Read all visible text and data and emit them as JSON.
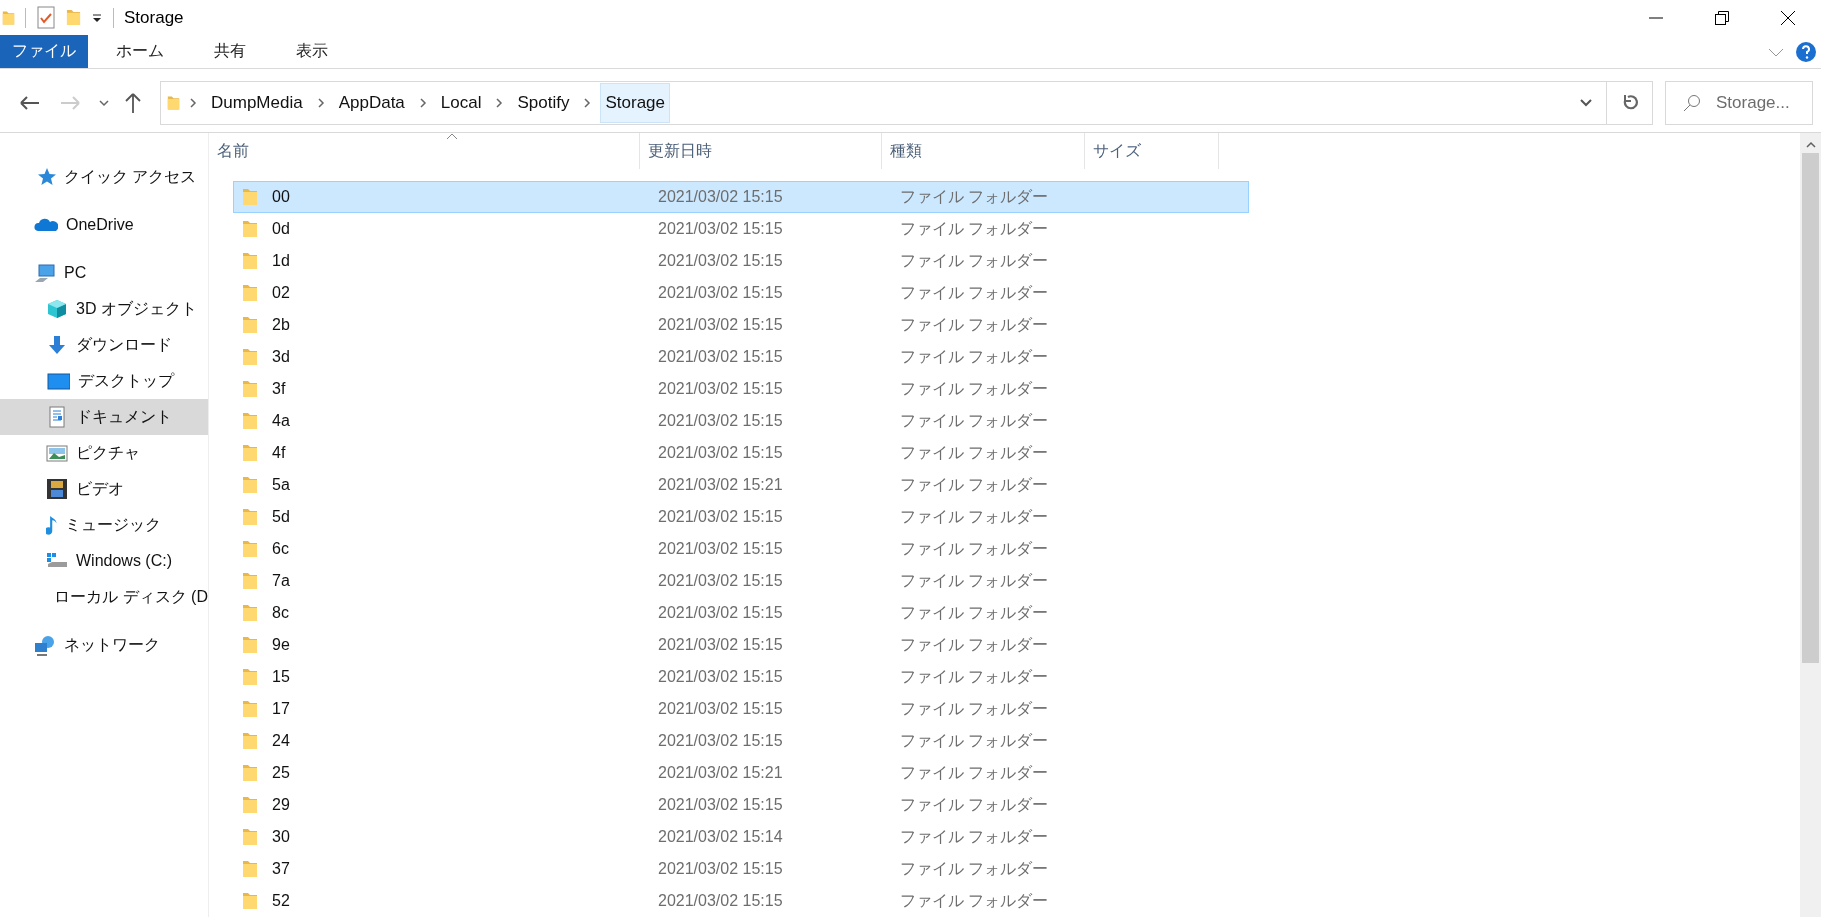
{
  "window": {
    "title": "Storage"
  },
  "ribbon": {
    "tabs": [
      {
        "label": "ファイル",
        "kind": "file"
      },
      {
        "label": "ホーム",
        "kind": "tab"
      },
      {
        "label": "共有",
        "kind": "tab"
      },
      {
        "label": "表示",
        "kind": "tab"
      }
    ]
  },
  "address": {
    "crumbs": [
      {
        "label": "DumpMedia",
        "selected": false
      },
      {
        "label": "AppData",
        "selected": false
      },
      {
        "label": "Local",
        "selected": false
      },
      {
        "label": "Spotify",
        "selected": false
      },
      {
        "label": "Storage",
        "selected": true
      }
    ]
  },
  "search": {
    "placeholder": "Storage..."
  },
  "sidebar": {
    "items": [
      {
        "label": "クイック アクセス",
        "kind": "star",
        "selected": false
      },
      {
        "label": "OneDrive",
        "kind": "cloud",
        "selected": false
      },
      {
        "label": "PC",
        "kind": "pc",
        "selected": false,
        "children": [
          {
            "label": "3D オブジェクト",
            "kind": "cube",
            "selected": false
          },
          {
            "label": "ダウンロード",
            "kind": "download",
            "selected": false
          },
          {
            "label": "デスクトップ",
            "kind": "desktop",
            "selected": false
          },
          {
            "label": "ドキュメント",
            "kind": "document",
            "selected": true
          },
          {
            "label": "ピクチャ",
            "kind": "picture",
            "selected": false
          },
          {
            "label": "ビデオ",
            "kind": "video",
            "selected": false
          },
          {
            "label": "ミュージック",
            "kind": "music",
            "selected": false
          },
          {
            "label": "Windows (C:)",
            "kind": "system-drive",
            "selected": false
          },
          {
            "label": "ローカル ディスク (D",
            "kind": "drive",
            "selected": false
          }
        ]
      },
      {
        "label": "ネットワーク",
        "kind": "network",
        "selected": false
      }
    ]
  },
  "columns": [
    "名前",
    "更新日時",
    "種類",
    "サイズ"
  ],
  "rows": [
    {
      "name": "00",
      "modified": "2021/03/02 15:15",
      "type": "ファイル フォルダー",
      "selected": true
    },
    {
      "name": "0d",
      "modified": "2021/03/02 15:15",
      "type": "ファイル フォルダー",
      "selected": false
    },
    {
      "name": "1d",
      "modified": "2021/03/02 15:15",
      "type": "ファイル フォルダー",
      "selected": false
    },
    {
      "name": "02",
      "modified": "2021/03/02 15:15",
      "type": "ファイル フォルダー",
      "selected": false
    },
    {
      "name": "2b",
      "modified": "2021/03/02 15:15",
      "type": "ファイル フォルダー",
      "selected": false
    },
    {
      "name": "3d",
      "modified": "2021/03/02 15:15",
      "type": "ファイル フォルダー",
      "selected": false
    },
    {
      "name": "3f",
      "modified": "2021/03/02 15:15",
      "type": "ファイル フォルダー",
      "selected": false
    },
    {
      "name": "4a",
      "modified": "2021/03/02 15:15",
      "type": "ファイル フォルダー",
      "selected": false
    },
    {
      "name": "4f",
      "modified": "2021/03/02 15:15",
      "type": "ファイル フォルダー",
      "selected": false
    },
    {
      "name": "5a",
      "modified": "2021/03/02 15:21",
      "type": "ファイル フォルダー",
      "selected": false
    },
    {
      "name": "5d",
      "modified": "2021/03/02 15:15",
      "type": "ファイル フォルダー",
      "selected": false
    },
    {
      "name": "6c",
      "modified": "2021/03/02 15:15",
      "type": "ファイル フォルダー",
      "selected": false
    },
    {
      "name": "7a",
      "modified": "2021/03/02 15:15",
      "type": "ファイル フォルダー",
      "selected": false
    },
    {
      "name": "8c",
      "modified": "2021/03/02 15:15",
      "type": "ファイル フォルダー",
      "selected": false
    },
    {
      "name": "9e",
      "modified": "2021/03/02 15:15",
      "type": "ファイル フォルダー",
      "selected": false
    },
    {
      "name": "15",
      "modified": "2021/03/02 15:15",
      "type": "ファイル フォルダー",
      "selected": false
    },
    {
      "name": "17",
      "modified": "2021/03/02 15:15",
      "type": "ファイル フォルダー",
      "selected": false
    },
    {
      "name": "24",
      "modified": "2021/03/02 15:15",
      "type": "ファイル フォルダー",
      "selected": false
    },
    {
      "name": "25",
      "modified": "2021/03/02 15:21",
      "type": "ファイル フォルダー",
      "selected": false
    },
    {
      "name": "29",
      "modified": "2021/03/02 15:15",
      "type": "ファイル フォルダー",
      "selected": false
    },
    {
      "name": "30",
      "modified": "2021/03/02 15:14",
      "type": "ファイル フォルダー",
      "selected": false
    },
    {
      "name": "37",
      "modified": "2021/03/02 15:15",
      "type": "ファイル フォルダー",
      "selected": false
    },
    {
      "name": "52",
      "modified": "2021/03/02 15:15",
      "type": "ファイル フォルダー",
      "selected": false
    }
  ]
}
